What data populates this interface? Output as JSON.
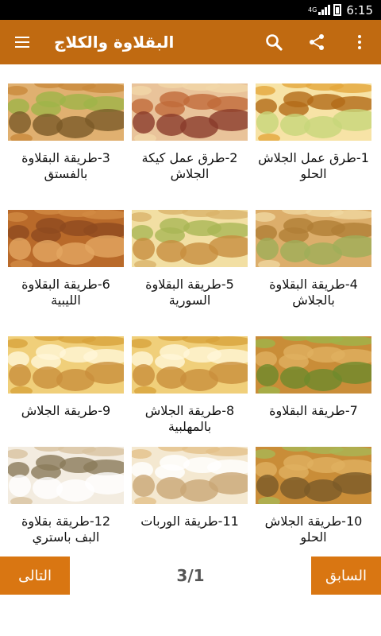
{
  "status": {
    "network": "4G",
    "time": "6:15"
  },
  "app_bar": {
    "title": "البقلاوة والكلاج"
  },
  "items": [
    {
      "label": "1-طرق عمل الجلاش الحلو",
      "palette": [
        "#f7e3a6",
        "#e4a63c",
        "#b26a18",
        "#c7d67a"
      ]
    },
    {
      "label": "2-طرق عمل كيكة الجلاش",
      "palette": [
        "#e9c39a",
        "#f1d7a8",
        "#c06a3a",
        "#8a3b2a"
      ]
    },
    {
      "label": "3-طريقة البقلاوة بالفستق",
      "palette": [
        "#e0b070",
        "#c98a3c",
        "#9fb449",
        "#7b5a28"
      ]
    },
    {
      "label": "4-طريقة البقلاوة بالجلاش",
      "palette": [
        "#dcae6b",
        "#f0d7a0",
        "#b07e36",
        "#9fae59"
      ]
    },
    {
      "label": "5-طريقة البقلاوة السورية",
      "palette": [
        "#f2dfa3",
        "#d9b36a",
        "#a9b655",
        "#c78d3f"
      ]
    },
    {
      "label": "6-طريقة البقلاوة الليبية",
      "palette": [
        "#b96a2a",
        "#d28b44",
        "#8e4a1f",
        "#e3a662"
      ]
    },
    {
      "label": "7-طريقة البقلاوة",
      "palette": [
        "#c98d38",
        "#9fb44a",
        "#e0b060",
        "#6e8a2c"
      ]
    },
    {
      "label": "8-طريقة الجلاش بالمهلبية",
      "palette": [
        "#f0cf7a",
        "#d8a23c",
        "#fff6d8",
        "#c98e3c"
      ]
    },
    {
      "label": "9-طريقة الجلاش",
      "palette": [
        "#f0cf7a",
        "#d8a23c",
        "#fff6d8",
        "#c98e3c"
      ]
    },
    {
      "label": "10-طريقة الجلاش الحلو",
      "palette": [
        "#c98d38",
        "#a9b655",
        "#e0b060",
        "#7b5a28"
      ]
    },
    {
      "label": "11-طريقة الوربات",
      "palette": [
        "#f4e8d0",
        "#e3c08a",
        "#ffffff",
        "#c9a676"
      ]
    },
    {
      "label": "12-طريقة بقلاوة البف باستري",
      "palette": [
        "#f3ece0",
        "#d8c3a0",
        "#8a7a5a",
        "#ffffff"
      ]
    }
  ],
  "pagination": {
    "page_label": "3/1"
  },
  "nav": {
    "next_label": "التالى",
    "prev_label": "السابق"
  },
  "colors": {
    "app_bar": "#c06a11",
    "button": "#d97612"
  },
  "icons": [
    "menu-icon",
    "search-icon",
    "share-icon",
    "more-vert-icon",
    "signal-icon",
    "battery-icon"
  ]
}
